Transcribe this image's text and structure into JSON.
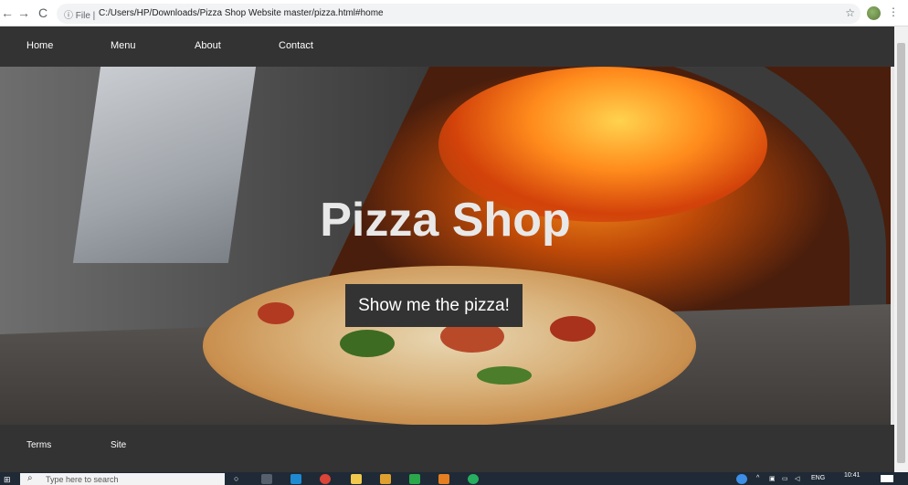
{
  "browser": {
    "back_icon": "←",
    "forward_icon": "→",
    "reload_icon": "C",
    "info_label": "ⓘ File |",
    "address": "C:/Users/HP/Downloads/Pizza Shop Website master/pizza.html#home",
    "bookmark_icon": "☆",
    "menu_icon": "⋮"
  },
  "site": {
    "nav": [
      "Home",
      "Menu",
      "About",
      "Contact"
    ],
    "hero_title": "Pizza Shop",
    "hero_button": "Show me the pizza!",
    "footer": [
      "Terms",
      "Site"
    ]
  },
  "taskbar": {
    "search_placeholder": "Type here to search",
    "language": "ENG",
    "time": "10:41"
  },
  "colors": {
    "nav_bg": "#333333",
    "fire": "#f28a1b",
    "taskbar": "#1f2a36"
  }
}
